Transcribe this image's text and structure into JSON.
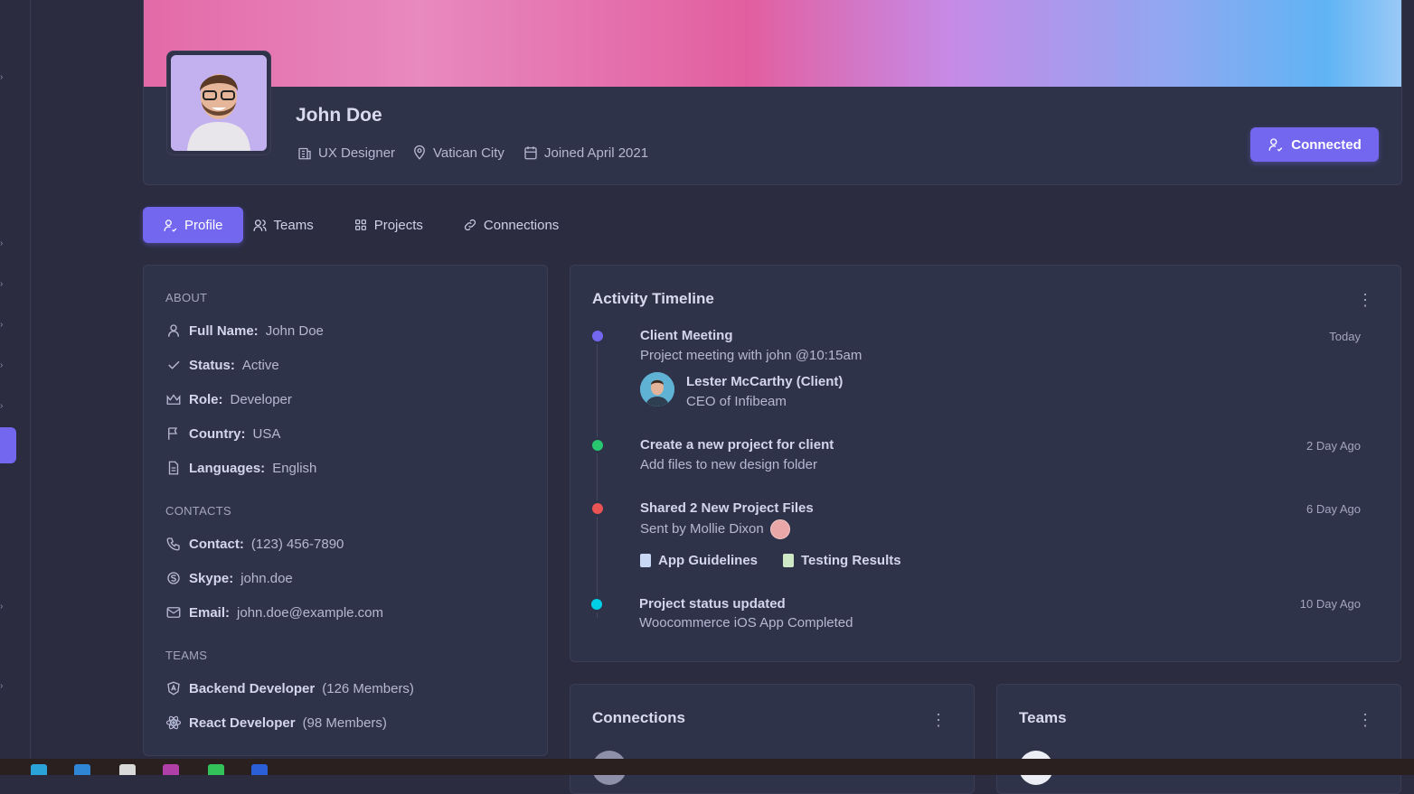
{
  "profile": {
    "name": "John Doe",
    "job": "UX Designer",
    "location": "Vatican City",
    "joined": "Joined April 2021",
    "connected_label": "Connected"
  },
  "tabs": [
    {
      "label": "Profile",
      "icon": "user-check-icon",
      "active": true
    },
    {
      "label": "Teams",
      "icon": "users-icon",
      "active": false
    },
    {
      "label": "Projects",
      "icon": "grid-icon",
      "active": false
    },
    {
      "label": "Connections",
      "icon": "link-icon",
      "active": false
    }
  ],
  "about": {
    "heading": "ABOUT",
    "items": [
      {
        "label": "Full Name:",
        "value": "John Doe"
      },
      {
        "label": "Status:",
        "value": "Active"
      },
      {
        "label": "Role:",
        "value": "Developer"
      },
      {
        "label": "Country:",
        "value": "USA"
      },
      {
        "label": "Languages:",
        "value": "English"
      }
    ],
    "contacts_heading": "CONTACTS",
    "contacts": [
      {
        "label": "Contact:",
        "value": "(123) 456-7890"
      },
      {
        "label": "Skype:",
        "value": "john.doe"
      },
      {
        "label": "Email:",
        "value": "john.doe@example.com"
      }
    ],
    "teams_heading": "TEAMS",
    "teams": [
      {
        "name": "Backend Developer",
        "members": "(126 Members)",
        "icon": "angular-icon",
        "color": "#ea5455"
      },
      {
        "name": "React Developer",
        "members": "(98 Members)",
        "icon": "react-icon",
        "color": "#00cfe8"
      }
    ]
  },
  "timeline": {
    "title": "Activity Timeline",
    "events": [
      {
        "title": "Client Meeting",
        "sub": "Project meeting with john @10:15am",
        "time": "Today",
        "color": "#7367f0",
        "client_name": "Lester McCarthy (Client)",
        "client_role": "CEO of Infibeam"
      },
      {
        "title": "Create a new project for client",
        "sub": "Add files to new design folder",
        "time": "2 Day Ago",
        "color": "#28c76f"
      },
      {
        "title": "Shared 2 New Project Files",
        "sub": "Sent by Mollie Dixon",
        "time": "6 Day Ago",
        "color": "#ea5455",
        "files": [
          "App Guidelines",
          "Testing Results"
        ]
      },
      {
        "title": "Project status updated",
        "sub": "Woocommerce iOS App Completed",
        "time": "10 Day Ago",
        "color": "#00cfe8"
      }
    ]
  },
  "connections": {
    "title": "Connections"
  },
  "teams_card": {
    "title": "Teams"
  },
  "colors": {
    "primary": "#7367f0",
    "background": "#2b2c40",
    "card": "#2f3349"
  }
}
